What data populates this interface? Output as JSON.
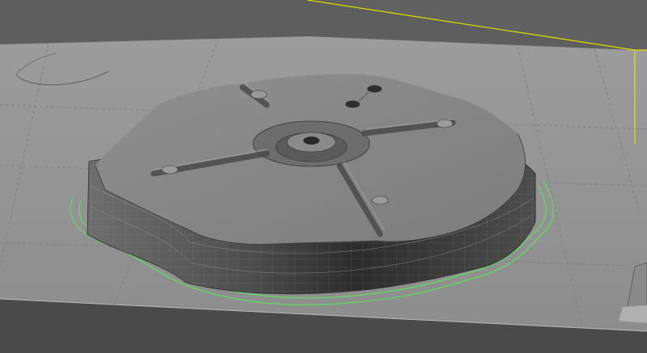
{
  "viewport": {
    "view": "3d-cam-viewport",
    "colors": {
      "background": "#5a5a5a",
      "table_top": "#9a9a9a",
      "table_front": "#4a4a4a",
      "stock_boundary": "#e0e000",
      "toolpath": "#5fdc5f",
      "part_top": "#8a8a8a",
      "part_wall_dark": "#303030",
      "part_wall_light": "#6b6b6b",
      "wireframe": "#b8b8b8"
    },
    "icons": [
      "grid-lines",
      "stock-box-outline",
      "toolpath-contour",
      "part-mesh",
      "fixture-fragment"
    ]
  }
}
